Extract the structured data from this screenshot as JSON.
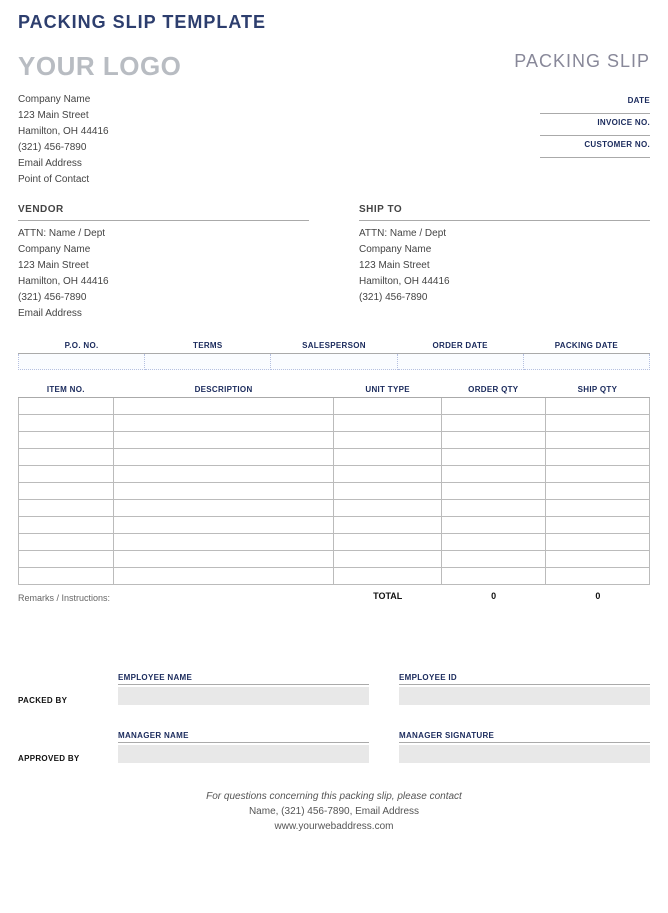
{
  "page_title": "PACKING SLIP TEMPLATE",
  "logo_text": "YOUR LOGO",
  "doc_type": "PACKING SLIP",
  "company": {
    "name": "Company Name",
    "street": "123 Main Street",
    "city_state_zip": "Hamilton, OH 44416",
    "phone": "(321) 456-7890",
    "email": "Email Address",
    "contact": "Point of Contact"
  },
  "meta_labels": {
    "date": "DATE",
    "invoice_no": "INVOICE NO.",
    "customer_no": "CUSTOMER NO."
  },
  "vendor": {
    "heading": "VENDOR",
    "attn": "ATTN: Name / Dept",
    "company": "Company Name",
    "street": "123 Main Street",
    "city_state_zip": "Hamilton, OH 44416",
    "phone": "(321) 456-7890",
    "email": "Email Address"
  },
  "ship_to": {
    "heading": "SHIP TO",
    "attn": "ATTN: Name / Dept",
    "company": "Company Name",
    "street": "123 Main Street",
    "city_state_zip": "Hamilton, OH 44416",
    "phone": "(321) 456-7890"
  },
  "order_meta_headers": {
    "po_no": "P.O. NO.",
    "terms": "TERMS",
    "salesperson": "SALESPERSON",
    "order_date": "ORDER DATE",
    "packing_date": "PACKING DATE"
  },
  "item_headers": {
    "item_no": "ITEM NO.",
    "description": "DESCRIPTION",
    "unit_type": "UNIT TYPE",
    "order_qty": "ORDER QTY",
    "ship_qty": "SHIP QTY"
  },
  "item_row_count": 11,
  "remarks_label": "Remarks / Instructions:",
  "total_label": "TOTAL",
  "total_order_qty": "0",
  "total_ship_qty": "0",
  "sign": {
    "packed_by": "PACKED BY",
    "approved_by": "APPROVED BY",
    "employee_name": "EMPLOYEE NAME",
    "employee_id": "EMPLOYEE ID",
    "manager_name": "MANAGER NAME",
    "manager_signature": "MANAGER SIGNATURE"
  },
  "footer": {
    "question_line": "For questions concerning this packing slip, please contact",
    "contact_line": "Name, (321) 456-7890, Email Address",
    "web": "www.yourwebaddress.com"
  }
}
